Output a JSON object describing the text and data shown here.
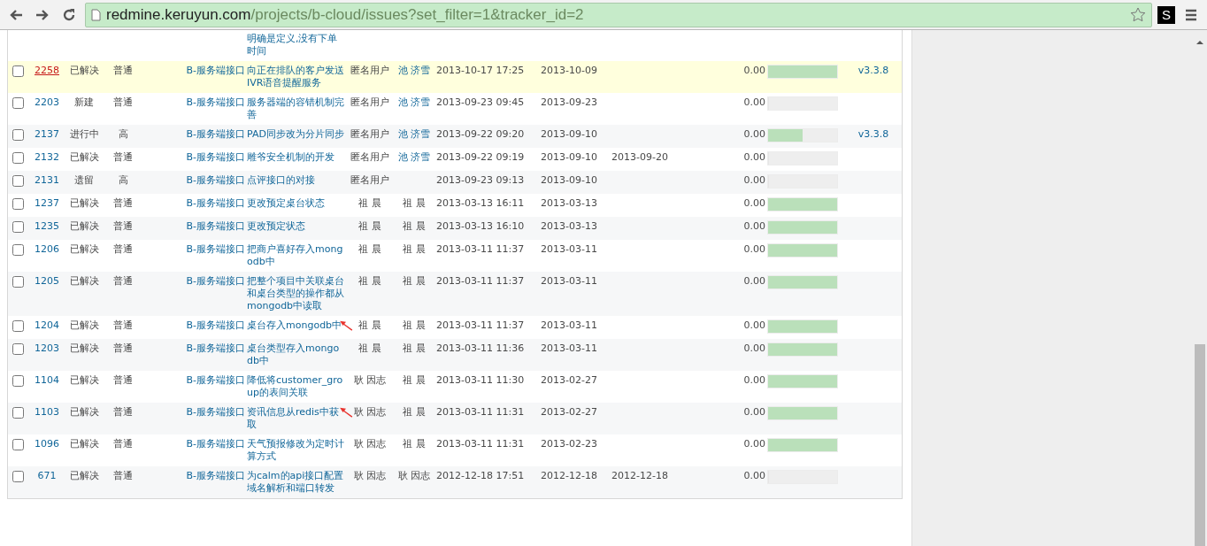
{
  "browser": {
    "url_host": "redmine.keruyun.com",
    "url_path": "/projects/b-cloud/issues?set_filter=1&tracker_id=2",
    "extension_label": "S"
  },
  "partial_row": {
    "subject": "明确是定义,没有下单时间"
  },
  "rows": [
    {
      "id": "2258",
      "status": "已解决",
      "priority": "普通",
      "tracker": "B-服务端接口",
      "subject": "向正在排队的客户发送IVR语音提醒服务",
      "author": "匿名用户",
      "assignee": "池 济雪",
      "assignee_linked": true,
      "updated": "2013-10-17 17:25",
      "start": "2013-10-09",
      "due": "",
      "estimated": "0.00",
      "level": 1,
      "version": "v3.3.8",
      "selected": true,
      "checked": false,
      "annotated": false
    },
    {
      "id": "2203",
      "status": "新建",
      "priority": "普通",
      "tracker": "B-服务端接口",
      "subject": "服务器端的容错机制完善",
      "author": "匿名用户",
      "assignee": "池 济雪",
      "assignee_linked": true,
      "updated": "2013-09-23 09:45",
      "start": "2013-09-23",
      "due": "",
      "estimated": "0.00",
      "level": 0,
      "version": "",
      "selected": false,
      "checked": false,
      "annotated": false
    },
    {
      "id": "2137",
      "status": "进行中",
      "priority": "高",
      "tracker": "B-服务端接口",
      "subject": "PAD同步改为分片同步",
      "author": "匿名用户",
      "assignee": "池 济雪",
      "assignee_linked": true,
      "updated": "2013-09-22 09:20",
      "start": "2013-09-10",
      "due": "",
      "estimated": "0.00",
      "level": 0.5,
      "version": "v3.3.8",
      "selected": false,
      "checked": false,
      "annotated": false
    },
    {
      "id": "2132",
      "status": "已解决",
      "priority": "普通",
      "tracker": "B-服务端接口",
      "subject": "雕爷安全机制的开发",
      "author": "匿名用户",
      "assignee": "池 济雪",
      "assignee_linked": true,
      "updated": "2013-09-22 09:19",
      "start": "2013-09-10",
      "due": "2013-09-20",
      "estimated": "0.00",
      "level": 0,
      "version": "",
      "selected": false,
      "checked": false,
      "annotated": false
    },
    {
      "id": "2131",
      "status": "遗留",
      "priority": "高",
      "tracker": "B-服务端接口",
      "subject": "点评接口的对接",
      "author": "匿名用户",
      "updated": "2013-09-23 09:13",
      "start": "2013-09-10",
      "estimated": "0.00",
      "level": 0,
      "version": "",
      "selected": false,
      "checked": false,
      "annotated": false
    },
    {
      "id": "1237",
      "status": "已解决",
      "priority": "普通",
      "tracker": "B-服务端接口",
      "subject": "更改预定桌台状态",
      "author": "祖 晨",
      "assignee": "祖 晨",
      "assignee_linked": false,
      "updated": "2013-03-13 16:11",
      "start": "2013-03-13",
      "due": "",
      "estimated": "0.00",
      "level": 1,
      "version": "",
      "selected": false,
      "checked": false,
      "annotated": false
    },
    {
      "id": "1235",
      "status": "已解决",
      "priority": "普通",
      "tracker": "B-服务端接口",
      "subject": "更改预定状态",
      "author": "祖 晨",
      "assignee": "祖 晨",
      "assignee_linked": false,
      "updated": "2013-03-13 16:10",
      "start": "2013-03-13",
      "due": "",
      "estimated": "0.00",
      "level": 1,
      "version": "",
      "selected": false,
      "checked": false,
      "annotated": false
    },
    {
      "id": "1206",
      "status": "已解决",
      "priority": "普通",
      "tracker": "B-服务端接口",
      "subject": "把商户喜好存入mongodb中",
      "author": "祖 晨",
      "assignee": "祖 晨",
      "assignee_linked": false,
      "updated": "2013-03-11 11:37",
      "start": "2013-03-11",
      "due": "",
      "estimated": "0.00",
      "level": 1,
      "version": "",
      "selected": false,
      "checked": false,
      "annotated": false
    },
    {
      "id": "1205",
      "status": "已解决",
      "priority": "普通",
      "tracker": "B-服务端接口",
      "subject": "把整个项目中关联桌台和桌台类型的操作都从mongodb中读取",
      "author": "祖 晨",
      "assignee": "祖 晨",
      "assignee_linked": false,
      "updated": "2013-03-11 11:37",
      "start": "2013-03-11",
      "due": "",
      "estimated": "0.00",
      "level": 1,
      "version": "",
      "selected": false,
      "checked": false,
      "annotated": false
    },
    {
      "id": "1204",
      "status": "已解决",
      "priority": "普通",
      "tracker": "B-服务端接口",
      "subject": "桌台存入mongodb中",
      "author": "祖 晨",
      "assignee": "祖 晨",
      "assignee_linked": false,
      "updated": "2013-03-11 11:37",
      "start": "2013-03-11",
      "due": "",
      "estimated": "0.00",
      "level": 1,
      "version": "",
      "selected": false,
      "checked": false,
      "annotated": true
    },
    {
      "id": "1203",
      "status": "已解决",
      "priority": "普通",
      "tracker": "B-服务端接口",
      "subject": "桌台类型存入mongodb中",
      "author": "祖 晨",
      "assignee": "祖 晨",
      "assignee_linked": false,
      "updated": "2013-03-11 11:36",
      "start": "2013-03-11",
      "due": "",
      "estimated": "0.00",
      "level": 1,
      "version": "",
      "selected": false,
      "checked": false,
      "annotated": false
    },
    {
      "id": "1104",
      "status": "已解决",
      "priority": "普通",
      "tracker": "B-服务端接口",
      "subject": "降低将customer_group的表间关联",
      "author": "耿 因志",
      "assignee": "祖 晨",
      "assignee_linked": false,
      "updated": "2013-03-11 11:30",
      "start": "2013-02-27",
      "due": "",
      "estimated": "0.00",
      "level": 1,
      "version": "",
      "selected": false,
      "checked": false,
      "annotated": false
    },
    {
      "id": "1103",
      "status": "已解决",
      "priority": "普通",
      "tracker": "B-服务端接口",
      "subject": "资讯信息从redis中获取",
      "author": "耿 因志",
      "assignee": "祖 晨",
      "assignee_linked": false,
      "updated": "2013-03-11 11:31",
      "start": "2013-02-27",
      "due": "",
      "estimated": "0.00",
      "level": 1,
      "version": "",
      "selected": false,
      "checked": false,
      "annotated": true
    },
    {
      "id": "1096",
      "status": "已解决",
      "priority": "普通",
      "tracker": "B-服务端接口",
      "subject": "天气预报修改为定时计算方式",
      "author": "耿 因志",
      "assignee": "祖 晨",
      "assignee_linked": false,
      "updated": "2013-03-11 11:31",
      "start": "2013-02-23",
      "due": "",
      "estimated": "0.00",
      "level": 1,
      "version": "",
      "selected": false,
      "checked": false,
      "annotated": false
    },
    {
      "id": "671",
      "status": "已解决",
      "priority": "普通",
      "tracker": "B-服务端接口",
      "subject": "为calm的api接口配置域名解析和端口转发",
      "author": "耿 因志",
      "assignee": "耿 因志",
      "assignee_linked": false,
      "updated": "2012-12-18 17:51",
      "start": "2012-12-18",
      "due": "2012-12-18",
      "estimated": "0.00",
      "level": 0,
      "version": "",
      "selected": false,
      "checked": false,
      "annotated": false
    }
  ]
}
